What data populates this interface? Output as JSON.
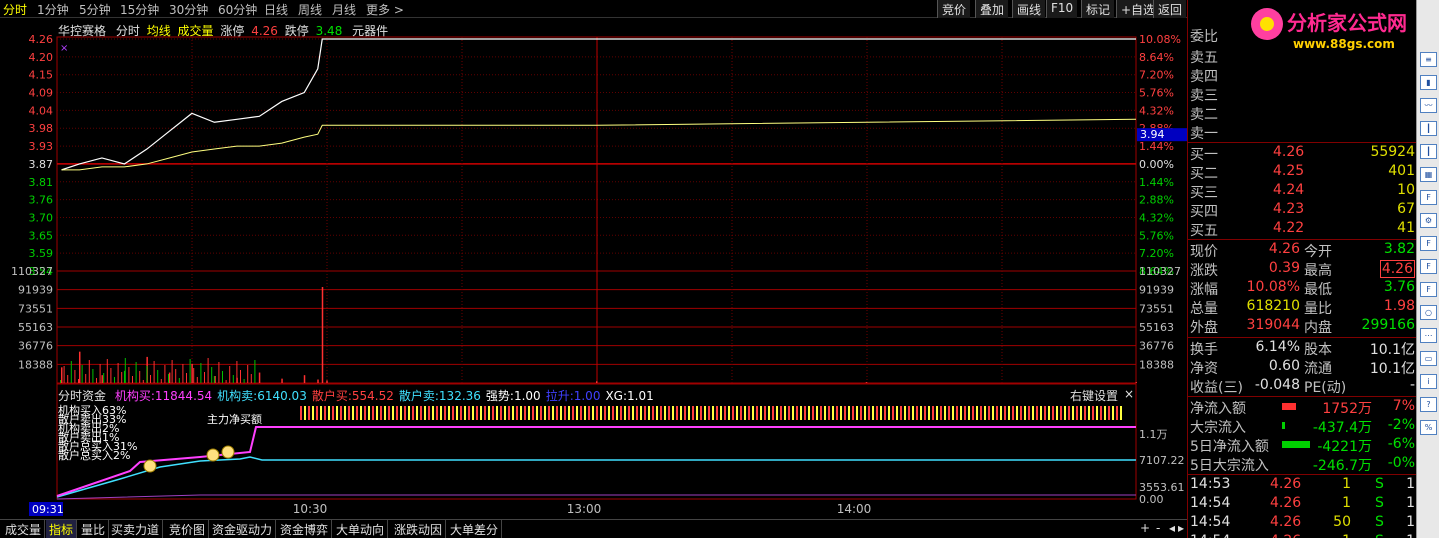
{
  "toolbar": {
    "periods": [
      "分时",
      "1分钟",
      "5分钟",
      "15分钟",
      "30分钟",
      "60分钟",
      "日线",
      "周线",
      "月线",
      "更多 >"
    ],
    "active_period": "分时",
    "buttons": [
      "竞价",
      "叠加",
      "画线",
      "F10",
      "标记",
      "+自选",
      "返回"
    ]
  },
  "stock_header": {
    "name": "华控赛格",
    "mode": "分时",
    "avg_label": "均线",
    "vol_label": "成交量",
    "limit_up_label": "涨停",
    "limit_up_value": "4.26",
    "limit_down_label": "跌停",
    "limit_down_value": "3.48",
    "sector": "元器件"
  },
  "price_axis": {
    "left_labels": [
      "4.26",
      "4.20",
      "4.15",
      "4.09",
      "4.04",
      "3.98",
      "3.93",
      "3.87",
      "3.81",
      "3.76",
      "3.70",
      "3.65",
      "3.59",
      "3.54"
    ],
    "right_labels": [
      "10.08%",
      "8.64%",
      "7.20%",
      "5.76%",
      "4.32%",
      "2.88%",
      "1.44%",
      "0.00%",
      "1.44%",
      "2.88%",
      "4.32%",
      "5.76%",
      "7.20%",
      "8.64%"
    ],
    "price_tag": "3.94",
    "ref_index": 7
  },
  "volume_axis": {
    "labels": [
      "110327",
      "91939",
      "73551",
      "55163",
      "36776",
      "18388"
    ]
  },
  "fund_indicator": {
    "title": "分时资金",
    "items": [
      {
        "label": "机构买:",
        "value": "11844.54",
        "color": "#ff40ff"
      },
      {
        "label": "机构卖:",
        "value": "6140.03",
        "color": "#40e0ff"
      },
      {
        "label": "散户买:",
        "value": "554.52",
        "color": "#ff4040"
      },
      {
        "label": "散户卖:",
        "value": "132.36",
        "color": "#40e0ff"
      },
      {
        "label": "强势:",
        "value": "1.00",
        "color": "#ffffff"
      },
      {
        "label": "拉升:",
        "value": "1.00",
        "color": "#4040ff"
      },
      {
        "label": "XG:",
        "value": "1.01",
        "color": "#ffffff"
      }
    ],
    "settings_label": "右键设置",
    "close_glyph": "×",
    "overlap_texts": [
      "机构买入63%",
      "散户卖出33%",
      "机构卖出2%",
      "散户卖出1%",
      "散户总买入31%",
      "散户总买入2%"
    ],
    "main_label": "主力净买额",
    "right_labels": [
      "1.1万",
      "7107.22",
      "3553.61",
      "0.00"
    ]
  },
  "time_axis": {
    "start": "09:31",
    "labels": [
      "10:30",
      "13:00",
      "14:00"
    ]
  },
  "bottom_tabs": [
    "成交量",
    "指标",
    "量比",
    "买卖力道",
    "竞价图",
    "资金驱动力",
    "资金博弈",
    "大单动向",
    "涨跌动因",
    "大单差分"
  ],
  "active_tab": "指标",
  "bottom_controls": [
    "+",
    "-",
    "◂",
    "▸"
  ],
  "order_book": {
    "weibi_label": "委比",
    "sells": [
      "卖五",
      "卖四",
      "卖三",
      "卖二",
      "卖一"
    ],
    "buys": [
      {
        "label": "买一",
        "price": "4.26",
        "vol": "55924"
      },
      {
        "label": "买二",
        "price": "4.25",
        "vol": "401"
      },
      {
        "label": "买三",
        "price": "4.24",
        "vol": "10"
      },
      {
        "label": "买四",
        "price": "4.23",
        "vol": "67"
      },
      {
        "label": "买五",
        "price": "4.22",
        "vol": "41"
      }
    ]
  },
  "quote": [
    {
      "l1": "现价",
      "v1": "4.26",
      "c1": "red",
      "l2": "今开",
      "v2": "3.82",
      "c2": "green"
    },
    {
      "l1": "涨跌",
      "v1": "0.39",
      "c1": "red",
      "l2": "最高",
      "v2": "4.26",
      "c2": "red"
    },
    {
      "l1": "涨幅",
      "v1": "10.08%",
      "c1": "red",
      "l2": "最低",
      "v2": "3.76",
      "c2": "green"
    },
    {
      "l1": "总量",
      "v1": "618210",
      "c1": "yellow",
      "l2": "量比",
      "v2": "1.98",
      "c2": "red"
    },
    {
      "l1": "外盘",
      "v1": "319044",
      "c1": "red",
      "l2": "内盘",
      "v2": "299166",
      "c2": "green"
    }
  ],
  "stats": [
    {
      "l1": "换手",
      "v1": "6.14%",
      "l2": "股本",
      "v2": "10.1亿"
    },
    {
      "l1": "净资",
      "v1": "0.60",
      "l2": "流通",
      "v2": "10.1亿"
    },
    {
      "l1": "收益(三)",
      "v1": "-0.048",
      "l2": "PE(动)",
      "v2": "-"
    }
  ],
  "flows": [
    {
      "label": "净流入额",
      "value": "1752万",
      "pct": "7%",
      "color": "red",
      "bar": 0.5
    },
    {
      "label": "大宗流入",
      "value": "-437.4万",
      "pct": "-2%",
      "color": "green",
      "bar": 0.1
    },
    {
      "label": "5日净流入额",
      "value": "-4221万",
      "pct": "-6%",
      "color": "green",
      "bar": 1.0
    },
    {
      "label": "5日大宗流入",
      "value": "-246.7万",
      "pct": "-0%",
      "color": "green",
      "bar": 0.0
    }
  ],
  "ticks": [
    {
      "time": "14:53",
      "price": "4.26",
      "vol": "1",
      "side": "S",
      "n": "1"
    },
    {
      "time": "14:54",
      "price": "4.26",
      "vol": "1",
      "side": "S",
      "n": "1"
    },
    {
      "time": "14:54",
      "price": "4.26",
      "vol": "50",
      "side": "S",
      "n": "1"
    },
    {
      "time": "14:54",
      "price": "4.26",
      "vol": "1",
      "side": "S",
      "n": "1"
    }
  ],
  "logo": {
    "text": "分析家公式网",
    "url": "www.88gs.com"
  },
  "icons": [
    "list-icon",
    "bar-chart-icon",
    "line-chart-icon",
    "candle-icon",
    "candle-icon-2",
    "table-icon",
    "f10-icon",
    "gear-icon",
    "chart-f1-icon",
    "chart-f2-icon",
    "chart-f3-icon",
    "circle-icon",
    "dots-icon",
    "screen-icon",
    "info-icon",
    "question-icon",
    "percent-icon"
  ],
  "chart_data": {
    "type": "line",
    "title": "华控赛格 分时",
    "prev_close": 3.87,
    "ylim": [
      3.48,
      4.26
    ],
    "price_series": {
      "name": "分时",
      "x": [
        "09:31",
        "09:35",
        "09:40",
        "09:45",
        "09:50",
        "09:55",
        "10:00",
        "10:05",
        "10:10",
        "10:15",
        "10:20",
        "10:25",
        "10:28",
        "10:29",
        "10:30",
        "11:30",
        "13:00",
        "14:00",
        "15:00"
      ],
      "values": [
        3.82,
        3.84,
        3.86,
        3.84,
        3.89,
        3.95,
        4.01,
        3.98,
        3.99,
        4.0,
        4.05,
        4.08,
        4.16,
        4.26,
        4.26,
        4.26,
        4.26,
        4.26,
        4.26
      ]
    },
    "avg_series": {
      "name": "均线",
      "values": [
        3.82,
        3.82,
        3.83,
        3.83,
        3.84,
        3.86,
        3.88,
        3.89,
        3.9,
        3.9,
        3.91,
        3.93,
        3.94,
        3.97,
        3.97,
        3.97,
        3.97,
        3.98,
        3.99
      ]
    },
    "volume": {
      "ylim": [
        0,
        128715
      ],
      "values": [
        18000,
        36000,
        9000,
        14000,
        30000,
        12000,
        22000,
        8000,
        6000,
        12000,
        5000,
        9000,
        4000,
        110327,
        3000,
        2000,
        1000,
        1000,
        1000
      ]
    }
  }
}
